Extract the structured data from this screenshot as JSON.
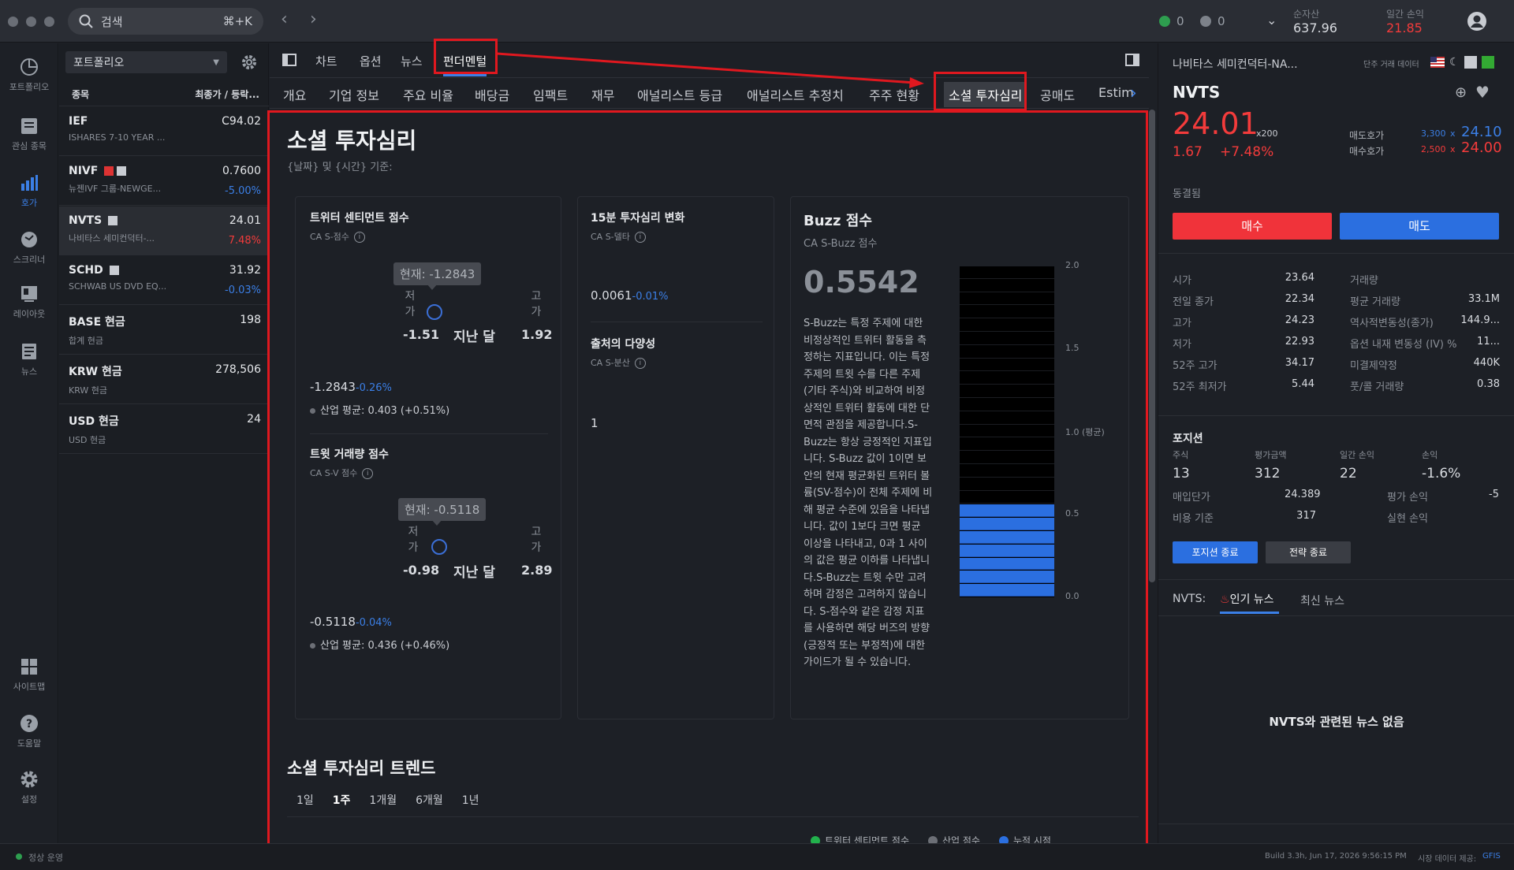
{
  "search": {
    "placeholder": "검색",
    "shortcut": "⌘+K"
  },
  "topbar": {
    "stat1": "0",
    "stat2": "0",
    "net_assets_label": "순자산",
    "net_assets_value": "637.96",
    "daily_pnl_label": "일간 손익",
    "daily_pnl_value": "21.85"
  },
  "rail": [
    {
      "label": "포트폴리오",
      "icon": "portfolio-icon"
    },
    {
      "label": "관심 종목",
      "icon": "watchlist-icon"
    },
    {
      "label": "호가",
      "icon": "quote-icon"
    },
    {
      "label": "스크리너",
      "icon": "screener-icon"
    },
    {
      "label": "레이아웃",
      "icon": "layout-icon"
    },
    {
      "label": "뉴스",
      "icon": "news-icon"
    },
    {
      "label": "사이트맵",
      "icon": "sitemap-icon"
    },
    {
      "label": "도움말",
      "icon": "help-icon"
    },
    {
      "label": "설정",
      "icon": "settings-icon"
    }
  ],
  "portfolio": {
    "dropdown": "포트폴리오",
    "col_symbol": "종목",
    "col_price": "최종가 / 등락...",
    "items": [
      {
        "sym": "IEF",
        "name": "ISHARES 7-10 YEAR ...",
        "price": "C94.02",
        "chg": ""
      },
      {
        "sym": "NIVF",
        "name": "뉴젠IVF 그룹-NEWGE...",
        "price": "0.7600",
        "chg": "-5.00%"
      },
      {
        "sym": "NVTS",
        "name": "나비타스 세미컨덕터-...",
        "price": "24.01",
        "chg": "7.48%"
      },
      {
        "sym": "SCHD",
        "name": "SCHWAB US DVD EQ...",
        "price": "31.92",
        "chg": "-0.03%"
      },
      {
        "sym": "BASE 현금",
        "name": "합계 현금",
        "price": "198",
        "chg": ""
      },
      {
        "sym": "KRW 현금",
        "name": "KRW 현금",
        "price": "278,506",
        "chg": ""
      },
      {
        "sym": "USD 현금",
        "name": "USD 현금",
        "price": "24",
        "chg": ""
      }
    ]
  },
  "tabs1": [
    "차트",
    "옵션",
    "뉴스",
    "펀더멘털"
  ],
  "tabs2": [
    "개요",
    "기업 정보",
    "주요 비율",
    "배당금",
    "임팩트",
    "재무",
    "애널리스트 등급",
    "애널리스트 추정치",
    "주주 현황",
    "소셜 투자심리",
    "공매도",
    "Estim"
  ],
  "social": {
    "title": "소셜 투자심리",
    "subtitle": "{날짜} 및 {시간} 기준:",
    "twitter": {
      "title": "트위터 센티먼트 점수",
      "sub": "CA S-점수",
      "tooltip": "현재: -1.2843",
      "low_label": "저\n가",
      "high_label": "고\n가",
      "low": "-1.51",
      "period": "지난 달",
      "high": "1.92",
      "value": "-1.2843",
      "change": "-0.26%",
      "avg": "산업 평균: 0.403 (+0.51%)"
    },
    "volume": {
      "title": "트윗 거래량 점수",
      "sub": "CA S-V 점수",
      "tooltip": "현재: -0.5118",
      "low": "-0.98",
      "period": "지난 달",
      "high": "2.89",
      "value": "-0.5118",
      "change": "-0.04%",
      "avg": "산업 평균: 0.436 (+0.46%)"
    },
    "delta": {
      "title": "15분 투자심리 변화",
      "sub": "CA S-델타",
      "value": "0.0061",
      "change": "-0.01%"
    },
    "diversity": {
      "title": "출처의 다양성",
      "sub": "CA S-분산",
      "value": "1"
    },
    "buzz": {
      "title": "Buzz 점수",
      "sub": "CA S-Buzz 점수",
      "value": "0.5542",
      "desc": "S-Buzz는 특정 주제에 대한 비정상적인 트위터 활동을 측정하는 지표입니다. 이는 특정 주제의 트윗 수를 다른 주제(기타 주식)와 비교하여 비정상적인 트위터 활동에 대한 단면적 관점을 제공합니다.S-Buzz는 항상 긍정적인 지표입니다. S-Buzz 값이 1이면 보안의 현재 평균화된 트위터 볼륨(SV-점수)이 전체 주제에 비해 평균 수준에 있음을 나타냅니다. 값이 1보다 크면 평균 이상을 나타내고, 0과 1 사이의 값은 평균 이하를 나타냅니다.S-Buzz는 트윗 수만 고려하며 감정은 고려하지 않습니다. S-점수와 같은 감정 지표를 사용하면 해당 버즈의 방향(긍정적 또는 부정적)에 대한 가이드가 될 수 있습니다.",
      "ticks": [
        "2.0",
        "1.5",
        "1.0 (평균)",
        "0.5",
        "0.0"
      ],
      "level": 0.5542,
      "max": 2.0
    },
    "trend": {
      "title": "소셜 투자심리 트렌드",
      "ranges": [
        "1일",
        "1주",
        "1개월",
        "6개월",
        "1년"
      ],
      "selected": "1주",
      "legend": [
        "트위터 센티먼트 점수",
        "산업 점수",
        "누적 시점"
      ],
      "legend_colors": [
        "#22b14c",
        "#6c6f76",
        "#2b6fe0"
      ]
    }
  },
  "quote": {
    "name": "나비타스 세미컨덕터-NA...",
    "data_label": "단주 거래 데이터",
    "symbol": "NVTS",
    "price": "24.01",
    "mult": "x200",
    "change": "1.67",
    "change_pct": "+7.48%",
    "ask_label": "매도호가",
    "ask_size": "3,300",
    "ask_x": "x",
    "ask_price": "24.10",
    "bid_label": "매수호가",
    "bid_size": "2,500",
    "bid_x": "x",
    "bid_price": "24.00",
    "status": "동결됨",
    "buy": "매수",
    "sell": "매도",
    "stats_left": [
      [
        "시가",
        "23.64"
      ],
      [
        "전일 종가",
        "22.34"
      ],
      [
        "고가",
        "24.23"
      ],
      [
        "저가",
        "22.93"
      ],
      [
        "52주 고가",
        "34.17"
      ],
      [
        "52주 최저가",
        "5.44"
      ]
    ],
    "stats_right": [
      [
        "거래량",
        ""
      ],
      [
        "평균 거래량",
        "33.1M"
      ],
      [
        "역사적변동성(종가)",
        "144.9..."
      ],
      [
        "옵션 내재 변동성 (IV) %",
        "11..."
      ],
      [
        "미결제약정",
        "440K"
      ],
      [
        "풋/콜 거래량",
        "0.38"
      ]
    ],
    "position": {
      "title": "포지션",
      "h_qty": "주식",
      "h_value": "평가금액",
      "h_daily": "일간 손익",
      "h_pnl": "손익",
      "qty": "13",
      "value": "312",
      "daily": "22",
      "pnl": "-1.6%",
      "avg_cost_label": "매입단가",
      "avg_cost": "24.389",
      "unreal_label": "평가 손익",
      "unreal": "-5",
      "cost_basis_label": "비용 기준",
      "cost_basis": "317",
      "real_label": "실현 손익",
      "close_btn": "포지션 종료",
      "strategy_btn": "전략 종료"
    },
    "news": {
      "prefix": "NVTS:",
      "tab_top": "인기 뉴스",
      "tab_latest": "최신 뉴스",
      "empty": "NVTS와 관련된 뉴스 없음"
    }
  },
  "status": {
    "state": "정상 운영",
    "build": "Build 3.3h, Jun 17, 2026 9:56:15 PM",
    "data_label": "시장 데이터 제공:",
    "provider": "GFIS"
  }
}
